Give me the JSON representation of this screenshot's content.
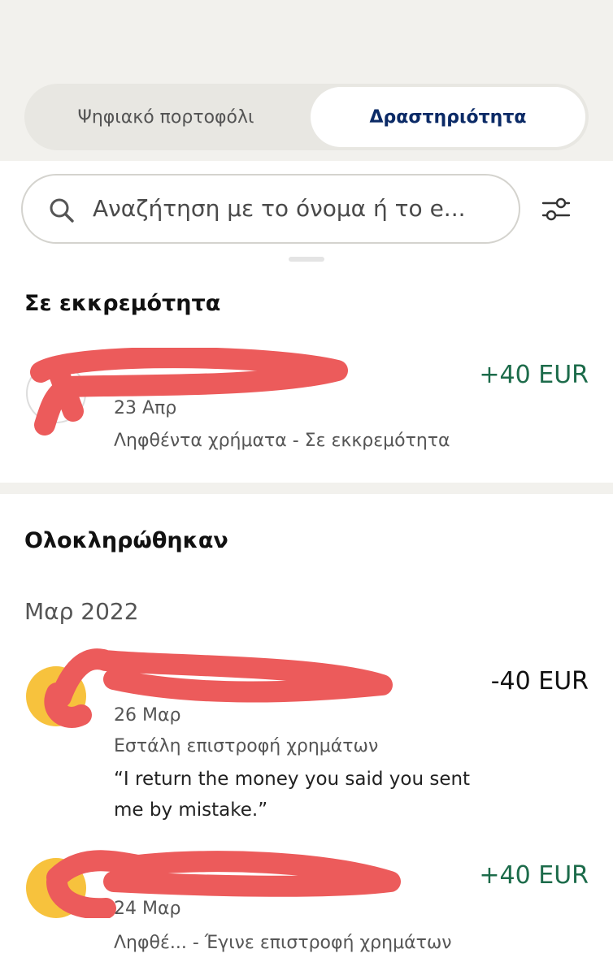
{
  "tabs": [
    {
      "label": "Ψηφιακό πορτοφόλι",
      "selected": false
    },
    {
      "label": "Δραστηριότητα",
      "selected": true
    }
  ],
  "search": {
    "placeholder": "Αναζήτηση με το όνομα ή το e..."
  },
  "pending": {
    "title": "Σε εκκρεμότητα",
    "items": [
      {
        "date": "23 Απρ",
        "subtitle": "Ληφθέντα χρήματα - Σε εκκρεμότητα",
        "amount": "+40 EUR"
      }
    ]
  },
  "completed": {
    "title": "Ολοκληρώθηκαν",
    "month": "Μαρ 2022",
    "items": [
      {
        "date": "26 Μαρ",
        "subtitle": "Εστάλη επιστροφή χρημάτων",
        "note": "“I return the money you said you sent me by mistake.”",
        "amount": "-40 EUR"
      },
      {
        "date": "24 Μαρ",
        "subtitle": "Ληφθέ... - Έγινε επιστροφή χρημάτων",
        "amount": "+40 EUR"
      }
    ]
  },
  "colors": {
    "accent": "#0b2a66",
    "positive": "#1c6b4a",
    "avatar": "#f7c23d",
    "redaction": "#ec5b5b"
  },
  "icons": {
    "search": "search-icon",
    "filter": "filter-sliders-icon"
  }
}
